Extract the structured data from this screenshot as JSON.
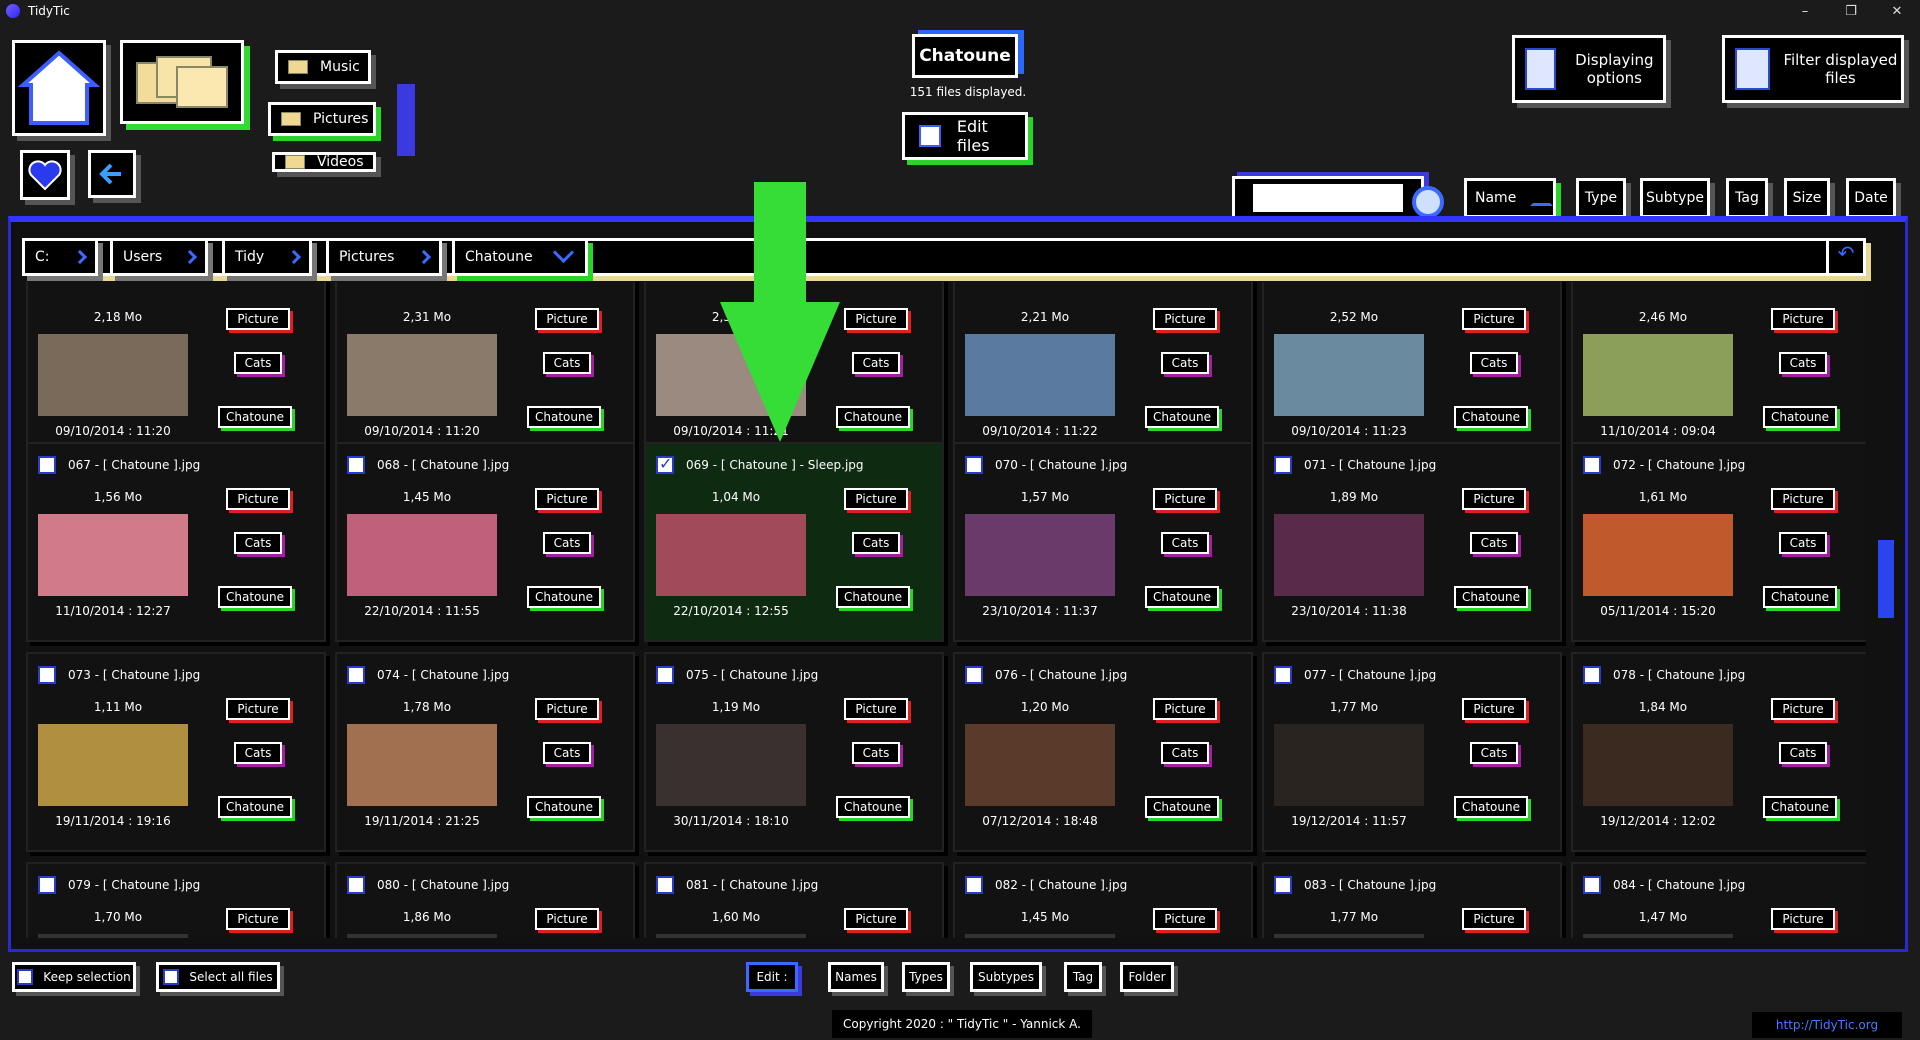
{
  "app": {
    "title": "TidyTic"
  },
  "window_controls": {
    "minimize": "–",
    "maximize": "❐",
    "close": "✕"
  },
  "folders": {
    "music": "Music",
    "pictures": "Pictures",
    "videos": "Videos"
  },
  "current_folder": {
    "title": "Chatoune",
    "files_displayed": "151 files displayed.",
    "edit_files": "Edit files"
  },
  "options": {
    "displaying": "Displaying options",
    "filter": "Filter displayed files"
  },
  "search": {
    "value": ""
  },
  "sort": {
    "name": "Name",
    "type": "Type",
    "subtype": "Subtype",
    "tag": "Tag",
    "size": "Size",
    "date": "Date"
  },
  "breadcrumb": [
    "C:",
    "Users",
    "Tidy",
    "Pictures",
    "Chatoune"
  ],
  "cards": [
    {
      "name": "",
      "size": "2,18 Mo",
      "date": "09/10/2014 : 11:20",
      "type": "Picture",
      "subtype": "Cats",
      "folder": "Chatoune",
      "thumb": "#7a6a5a"
    },
    {
      "name": "",
      "size": "2,31 Mo",
      "date": "09/10/2014 : 11:20",
      "type": "Picture",
      "subtype": "Cats",
      "folder": "Chatoune",
      "thumb": "#8a7a6a"
    },
    {
      "name": "",
      "size": "2,30 Mo",
      "date": "09/10/2014 : 11:21",
      "type": "Picture",
      "subtype": "Cats",
      "folder": "Chatoune",
      "thumb": "#9a8a80"
    },
    {
      "name": "",
      "size": "2,21 Mo",
      "date": "09/10/2014 : 11:22",
      "type": "Picture",
      "subtype": "Cats",
      "folder": "Chatoune",
      "thumb": "#5a7aa0"
    },
    {
      "name": "",
      "size": "2,52 Mo",
      "date": "09/10/2014 : 11:23",
      "type": "Picture",
      "subtype": "Cats",
      "folder": "Chatoune",
      "thumb": "#6a8aa0"
    },
    {
      "name": "",
      "size": "2,46 Mo",
      "date": "11/10/2014 : 09:04",
      "type": "Picture",
      "subtype": "Cats",
      "folder": "Chatoune",
      "thumb": "#8aa05a"
    },
    {
      "name": "067 - [ Chatoune ].jpg",
      "size": "1,56 Mo",
      "date": "11/10/2014 : 12:27",
      "type": "Picture",
      "subtype": "Cats",
      "folder": "Chatoune",
      "thumb": "#d07a8a"
    },
    {
      "name": "068 - [ Chatoune ].jpg",
      "size": "1,45 Mo",
      "date": "22/10/2014 : 11:55",
      "type": "Picture",
      "subtype": "Cats",
      "folder": "Chatoune",
      "thumb": "#c0607a"
    },
    {
      "name": "069 - [ Chatoune ] - Sleep.jpg",
      "size": "1,04 Mo",
      "date": "22/10/2014 : 12:55",
      "type": "Picture",
      "subtype": "Cats",
      "folder": "Chatoune",
      "thumb": "#a04a5a",
      "selected": true
    },
    {
      "name": "070 - [ Chatoune ].jpg",
      "size": "1,57 Mo",
      "date": "23/10/2014 : 11:37",
      "type": "Picture",
      "subtype": "Cats",
      "folder": "Chatoune",
      "thumb": "#6a3a6a"
    },
    {
      "name": "071 - [ Chatoune ].jpg",
      "size": "1,89 Mo",
      "date": "23/10/2014 : 11:38",
      "type": "Picture",
      "subtype": "Cats",
      "folder": "Chatoune",
      "thumb": "#5a2a4a"
    },
    {
      "name": "072 - [ Chatoune ].jpg",
      "size": "1,61 Mo",
      "date": "05/11/2014 : 15:20",
      "type": "Picture",
      "subtype": "Cats",
      "folder": "Chatoune",
      "thumb": "#c05a2a"
    },
    {
      "name": "073 - [ Chatoune ].jpg",
      "size": "1,11 Mo",
      "date": "19/11/2014 : 19:16",
      "type": "Picture",
      "subtype": "Cats",
      "folder": "Chatoune",
      "thumb": "#b09040"
    },
    {
      "name": "074 - [ Chatoune ].jpg",
      "size": "1,78 Mo",
      "date": "19/11/2014 : 21:25",
      "type": "Picture",
      "subtype": "Cats",
      "folder": "Chatoune",
      "thumb": "#a07050"
    },
    {
      "name": "075 - [ Chatoune ].jpg",
      "size": "1,19 Mo",
      "date": "30/11/2014 : 18:10",
      "type": "Picture",
      "subtype": "Cats",
      "folder": "Chatoune",
      "thumb": "#3a3030"
    },
    {
      "name": "076 - [ Chatoune ].jpg",
      "size": "1,20 Mo",
      "date": "07/12/2014 : 18:48",
      "type": "Picture",
      "subtype": "Cats",
      "folder": "Chatoune",
      "thumb": "#5a3a2a"
    },
    {
      "name": "077 - [ Chatoune ].jpg",
      "size": "1,77 Mo",
      "date": "19/12/2014 : 11:57",
      "type": "Picture",
      "subtype": "Cats",
      "folder": "Chatoune",
      "thumb": "#2a2420"
    },
    {
      "name": "078 - [ Chatoune ].jpg",
      "size": "1,84 Mo",
      "date": "19/12/2014 : 12:02",
      "type": "Picture",
      "subtype": "Cats",
      "folder": "Chatoune",
      "thumb": "#3a2a20"
    },
    {
      "name": "079 - [ Chatoune ].jpg",
      "size": "1,70 Mo",
      "date": "",
      "type": "Picture",
      "subtype": "",
      "folder": "",
      "thumb": "#333"
    },
    {
      "name": "080 - [ Chatoune ].jpg",
      "size": "1,86 Mo",
      "date": "",
      "type": "Picture",
      "subtype": "",
      "folder": "",
      "thumb": "#333"
    },
    {
      "name": "081 - [ Chatoune ].jpg",
      "size": "1,60 Mo",
      "date": "",
      "type": "Picture",
      "subtype": "",
      "folder": "",
      "thumb": "#333"
    },
    {
      "name": "082 - [ Chatoune ].jpg",
      "size": "1,45 Mo",
      "date": "",
      "type": "Picture",
      "subtype": "",
      "folder": "",
      "thumb": "#333"
    },
    {
      "name": "083 - [ Chatoune ].jpg",
      "size": "1,77 Mo",
      "date": "",
      "type": "Picture",
      "subtype": "",
      "folder": "",
      "thumb": "#333"
    },
    {
      "name": "084 - [ Chatoune ].jpg",
      "size": "1,47 Mo",
      "date": "",
      "type": "Picture",
      "subtype": "",
      "folder": "",
      "thumb": "#333"
    }
  ],
  "footer": {
    "keep_selection": "Keep selection",
    "select_all": "Select all files",
    "edit": "Edit :",
    "names": "Names",
    "types": "Types",
    "subtypes": "Subtypes",
    "tag": "Tag",
    "folder": "Folder",
    "copyright": "Copyright 2020 : \" TidyTic \" - Yannick A.",
    "url": "http://TidyTic.org"
  },
  "colors": {
    "accent": "#3535ff",
    "green": "#2ad32a",
    "type_red": "#e02020",
    "subtype_purple": "#a020a0"
  }
}
